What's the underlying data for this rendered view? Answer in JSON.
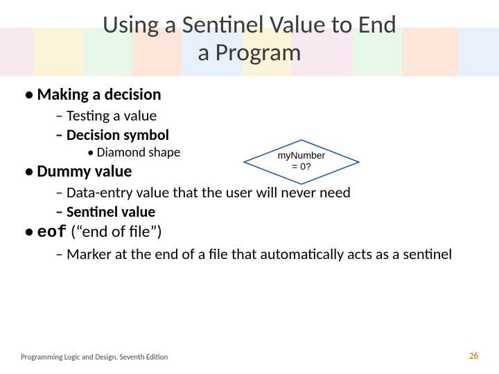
{
  "title_line1": "Using a Sentinel Value to End",
  "title_line2": "a Program",
  "bullets": {
    "b1": "Making a decision",
    "b1a": "Testing a value",
    "b1b": "Decision symbol",
    "b1b1": "Diamond shape",
    "b2": "Dummy value",
    "b2a": "Data-entry value that the user will never need",
    "b2b": "Sentinel value",
    "b3_code": "eof",
    "b3_rest": " (“end of file”)",
    "b3a": "Marker at the end of a file that automatically acts as a sentinel"
  },
  "decision_symbol": {
    "line1": "myNumber",
    "line2": "= 0?"
  },
  "footer": {
    "source": "Programming Logic and Design, Seventh Edition",
    "page": "26"
  },
  "chart_data": {
    "type": "table",
    "note": "Presentation slide; no quantitative chart data present."
  }
}
